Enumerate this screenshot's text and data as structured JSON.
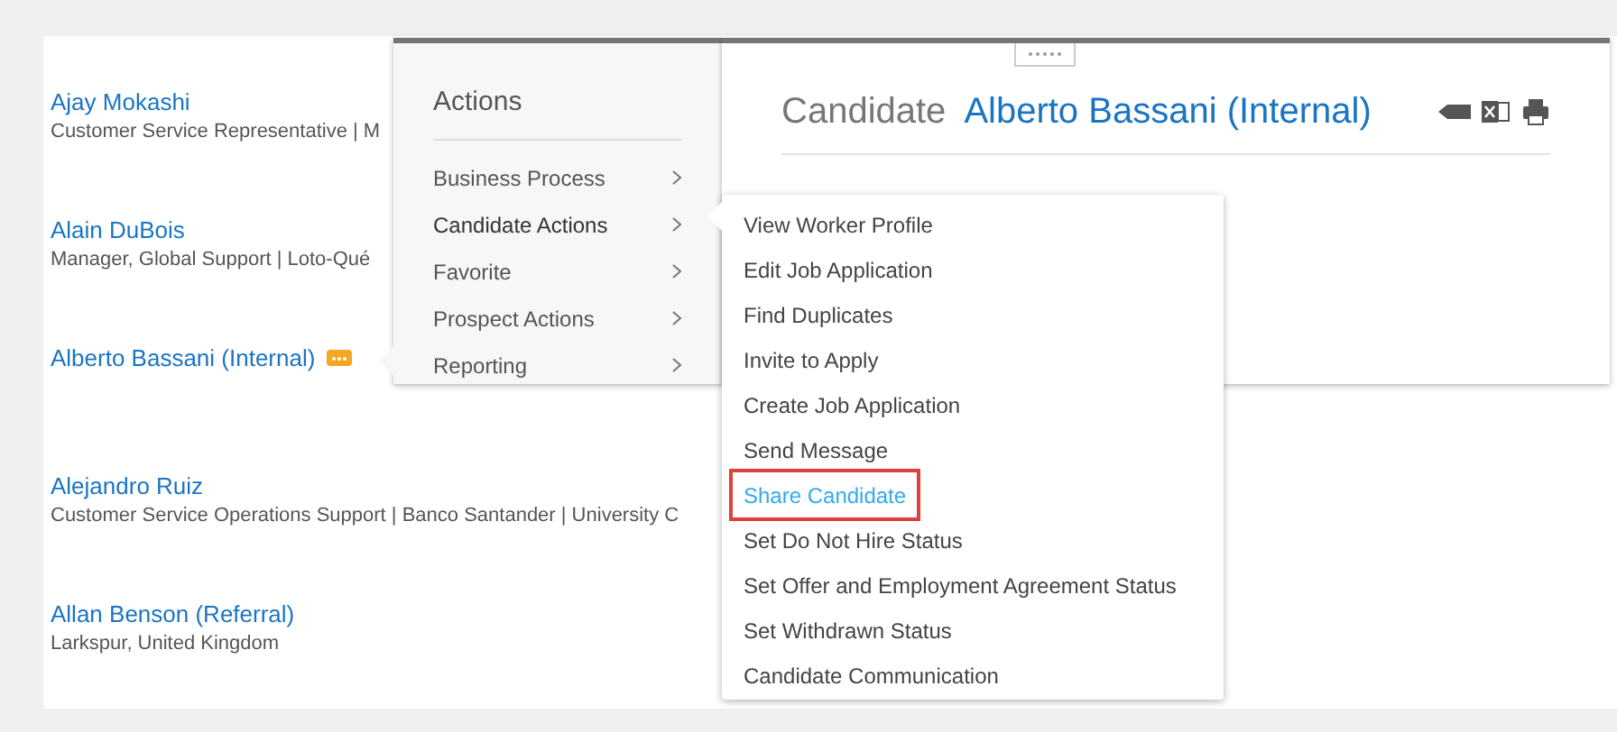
{
  "candidates": [
    {
      "name": "Ajay Mokashi",
      "detail": "Customer Service Representative | M",
      "has_menu_badge": false
    },
    {
      "name": "Alain DuBois",
      "detail": "Manager, Global Support | Loto-Qué",
      "has_menu_badge": false
    },
    {
      "name": "Alberto Bassani (Internal)",
      "has_menu_badge": true
    },
    {
      "name": "Alejandro Ruiz",
      "detail": "Customer Service Operations Support | Banco Santander | University C",
      "has_menu_badge": false
    },
    {
      "name": "Allan Benson (Referral)",
      "detail": "Larkspur, United Kingdom",
      "has_menu_badge": false
    }
  ],
  "actions_menu": {
    "title": "Actions",
    "items": [
      {
        "label": "Business Process",
        "expanded": false
      },
      {
        "label": "Candidate Actions",
        "expanded": true
      },
      {
        "label": "Favorite",
        "expanded": false
      },
      {
        "label": "Prospect Actions",
        "expanded": false
      },
      {
        "label": "Reporting",
        "expanded": false
      }
    ]
  },
  "candidate_card": {
    "label": "Candidate",
    "name": "Alberto Bassani (Internal)"
  },
  "submenu": [
    {
      "label": "View Worker Profile",
      "selected": false
    },
    {
      "label": "Edit Job Application",
      "selected": false
    },
    {
      "label": "Find Duplicates",
      "selected": false
    },
    {
      "label": "Invite to Apply",
      "selected": false
    },
    {
      "label": "Create Job Application",
      "selected": false
    },
    {
      "label": "Send Message",
      "selected": false
    },
    {
      "label": "Share Candidate",
      "selected": true
    },
    {
      "label": "Set Do Not Hire Status",
      "selected": false
    },
    {
      "label": "Set Offer and Employment Agreement Status",
      "selected": false
    },
    {
      "label": "Set Withdrawn Status",
      "selected": false
    },
    {
      "label": "Candidate Communication",
      "selected": false
    }
  ]
}
